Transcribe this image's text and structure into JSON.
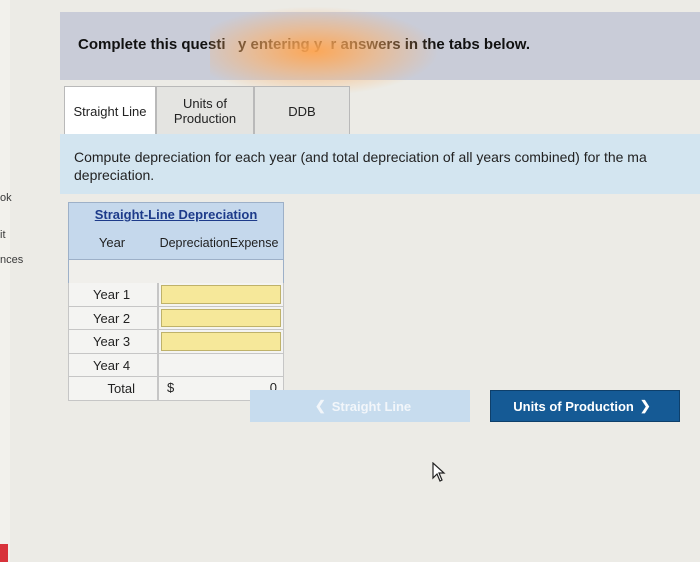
{
  "header": {
    "instruction": "Complete this questi   y entering y  r answers in the tabs below."
  },
  "side_labels": [
    "ok",
    "it",
    "nces"
  ],
  "tabs": [
    {
      "label": "Straight Line",
      "active": true
    },
    {
      "label_line1": "Units of",
      "label_line2": "Production",
      "active": false
    },
    {
      "label": "DDB",
      "active": false
    }
  ],
  "instructions": {
    "line1": "Compute depreciation for each year (and total depreciation of all years combined) for the ma",
    "line2": "depreciation."
  },
  "table": {
    "title": "Straight-Line Depreciation",
    "col_year": "Year",
    "col_dep_line1": "Depreciation",
    "col_dep_line2": "Expense",
    "rows": [
      {
        "year": "Year 1",
        "value": ""
      },
      {
        "year": "Year 2",
        "value": ""
      },
      {
        "year": "Year 3",
        "value": ""
      },
      {
        "year": "Year 4",
        "value": ""
      }
    ],
    "total": {
      "label": "Total",
      "prefix": "$",
      "value": "0"
    }
  },
  "nav": {
    "prev_label": "Straight Line",
    "next_label": "Units of Production",
    "prev_icon": "chevron-left-icon",
    "next_icon": "chevron-right-icon"
  },
  "colors": {
    "accent": "#155a95",
    "input_fill": "#f6e89a",
    "panel_blue": "#d3e5f0",
    "banner": "#c9ccd8"
  }
}
